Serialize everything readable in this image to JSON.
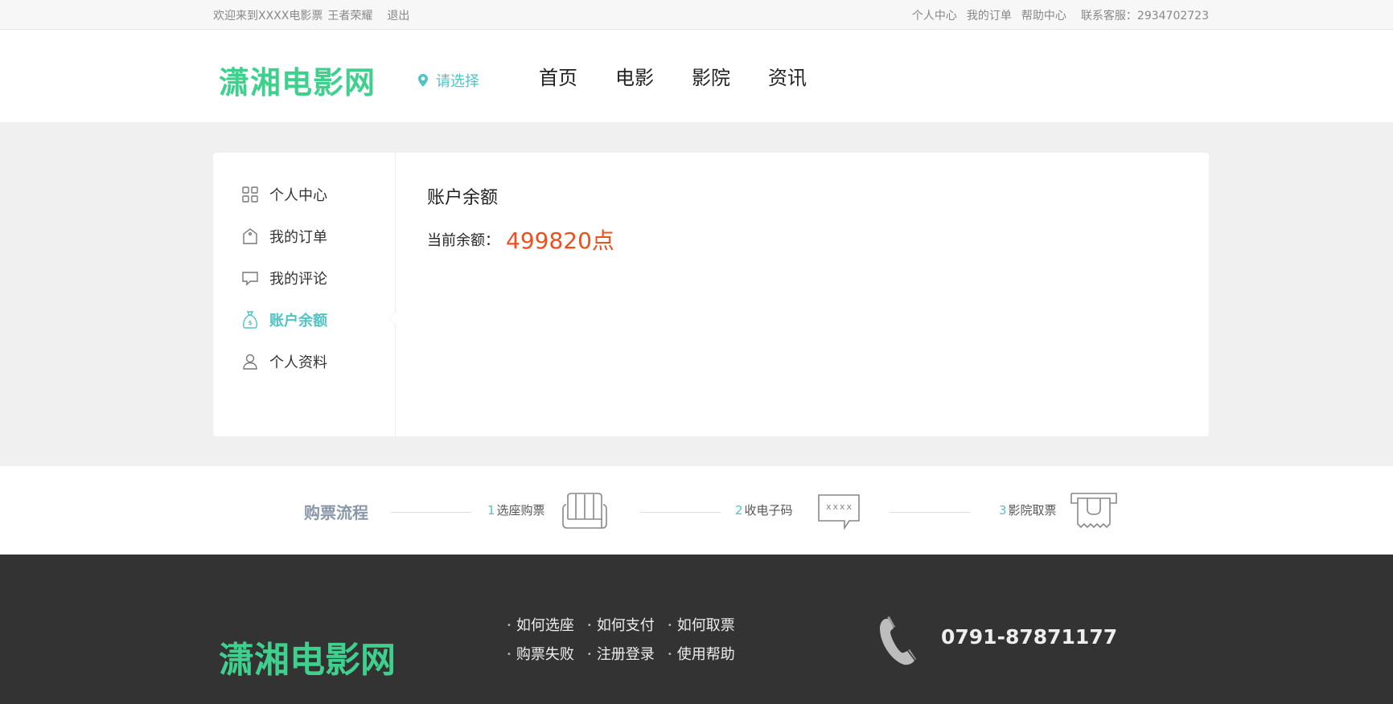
{
  "topbar": {
    "welcome": "欢迎来到XXXX电影票",
    "user": "王者荣耀",
    "logout": "退出",
    "links": [
      "个人中心",
      "我的订单",
      "帮助中心"
    ],
    "service": "联系客服：2934702723"
  },
  "header": {
    "logo": "潇湘电影网",
    "city": "请选择",
    "nav": [
      "首页",
      "电影",
      "影院",
      "资讯"
    ]
  },
  "sidebar": {
    "items": [
      {
        "label": "个人中心",
        "icon": "grid-icon"
      },
      {
        "label": "我的订单",
        "icon": "tag-icon"
      },
      {
        "label": "我的评论",
        "icon": "comment-icon"
      },
      {
        "label": "账户余额",
        "icon": "money-bag-icon",
        "active": true
      },
      {
        "label": "个人资料",
        "icon": "user-icon"
      }
    ]
  },
  "content": {
    "title": "账户余额",
    "balance_label": "当前余额：",
    "balance_value": "499820点"
  },
  "process": {
    "title": "购票流程",
    "steps": [
      {
        "num": "1",
        "label": "选座购票",
        "icon": "seat-icon"
      },
      {
        "num": "2",
        "label": "收电子码",
        "icon": "message-icon",
        "icon_text": "xxxx"
      },
      {
        "num": "3",
        "label": "影院取票",
        "icon": "ticket-machine-icon"
      }
    ]
  },
  "footer": {
    "logo": "潇湘电影网",
    "links_row1": [
      "如何选座",
      "如何支付",
      "如何取票"
    ],
    "links_row2": [
      "购票失败",
      "注册登录",
      "使用帮助"
    ],
    "phone": "0791-87871177"
  },
  "colors": {
    "accent": "#4ec4c4",
    "logo": "#3fd08e",
    "balance": "#ee4f1b",
    "footer_bg": "#333333"
  }
}
